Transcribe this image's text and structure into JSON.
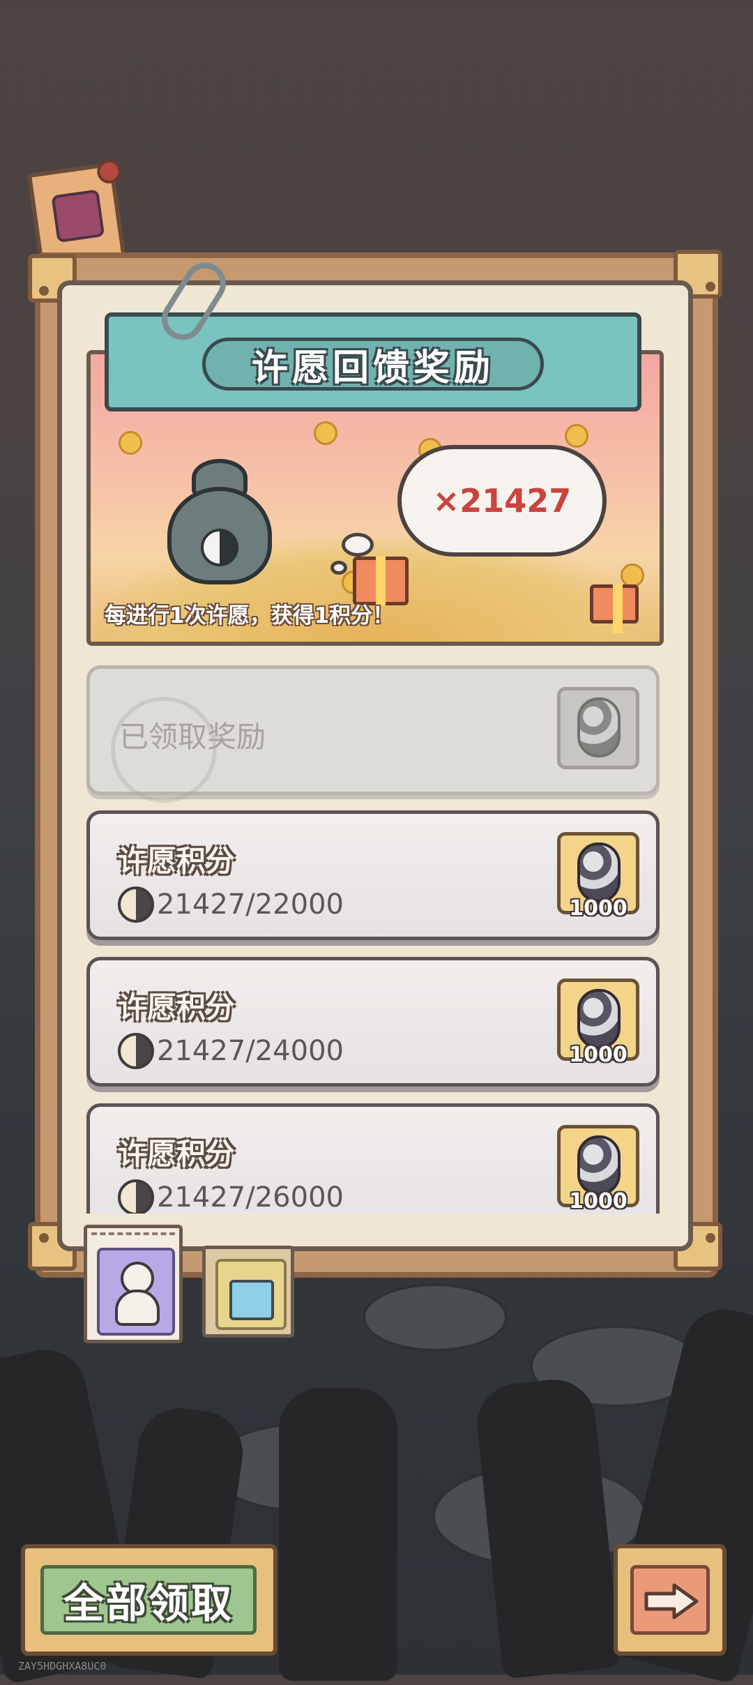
{
  "panel": {
    "title": "许愿回馈奖励",
    "bubble_count": "×21427",
    "subtitle": "每进行1次许愿，获得1积分！"
  },
  "claimed_row": {
    "label": "已领取奖励"
  },
  "reward_rows": [
    {
      "label": "许愿积分",
      "progress": "21427/22000",
      "reward_qty": "1000"
    },
    {
      "label": "许愿积分",
      "progress": "21427/24000",
      "reward_qty": "1000"
    },
    {
      "label": "许愿积分",
      "progress": "21427/26000",
      "reward_qty": "1000"
    }
  ],
  "tabs": [
    {
      "icon": "doll-icon",
      "selected": true
    },
    {
      "icon": "gift-icon",
      "selected": false
    }
  ],
  "buttons": {
    "collect_all": "全部领取",
    "next_icon": "arrow-right-icon"
  },
  "watermark": "ZAY5HDGHXA8UC0",
  "colors": {
    "title_ribbon": "#79c3c0",
    "bubble_count": "#c9443c",
    "collect_button": "#9ec68e",
    "next_button": "#ea9a78"
  }
}
